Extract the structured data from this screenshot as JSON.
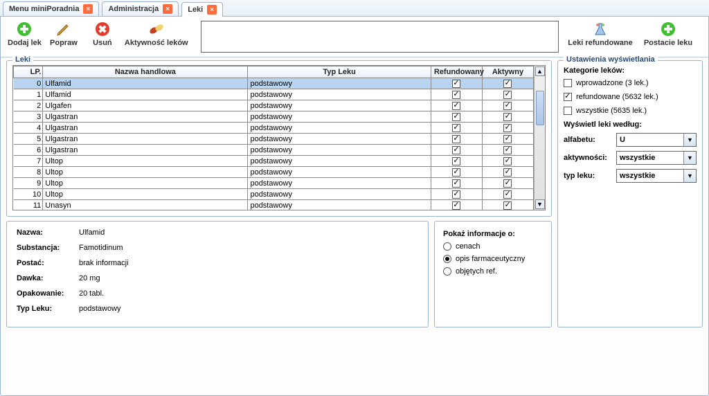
{
  "tabs": [
    {
      "label": "Menu miniPoradnia"
    },
    {
      "label": "Administracja"
    },
    {
      "label": "Leki"
    }
  ],
  "toolbar": {
    "add": "Dodaj lek",
    "edit": "Popraw",
    "del": "Usuń",
    "activity": "Aktywność leków",
    "refunded": "Leki refundowane",
    "forms": "Postacie leku"
  },
  "table": {
    "group_label": "Leki",
    "headers": {
      "lp": "LP.",
      "name": "Nazwa handlowa",
      "type": "Typ Leku",
      "ref": "Refundowany",
      "akt": "Aktywny"
    },
    "rows": [
      {
        "lp": 0,
        "name": "Ulfamid",
        "type": "podstawowy",
        "ref": true,
        "akt": true,
        "sel": true
      },
      {
        "lp": 1,
        "name": "Ulfamid",
        "type": "podstawowy",
        "ref": true,
        "akt": true
      },
      {
        "lp": 2,
        "name": "Ulgafen",
        "type": "podstawowy",
        "ref": true,
        "akt": true
      },
      {
        "lp": 3,
        "name": "Ulgastran",
        "type": "podstawowy",
        "ref": true,
        "akt": true
      },
      {
        "lp": 4,
        "name": "Ulgastran",
        "type": "podstawowy",
        "ref": true,
        "akt": true
      },
      {
        "lp": 5,
        "name": "Ulgastran",
        "type": "podstawowy",
        "ref": true,
        "akt": true
      },
      {
        "lp": 6,
        "name": "Ulgastran",
        "type": "podstawowy",
        "ref": true,
        "akt": true
      },
      {
        "lp": 7,
        "name": "Ultop",
        "type": "podstawowy",
        "ref": true,
        "akt": true
      },
      {
        "lp": 8,
        "name": "Ultop",
        "type": "podstawowy",
        "ref": true,
        "akt": true
      },
      {
        "lp": 9,
        "name": "Ultop",
        "type": "podstawowy",
        "ref": true,
        "akt": true
      },
      {
        "lp": 10,
        "name": "Ultop",
        "type": "podstawowy",
        "ref": true,
        "akt": true
      },
      {
        "lp": 11,
        "name": "Unasyn",
        "type": "podstawowy",
        "ref": true,
        "akt": true
      }
    ]
  },
  "detail": {
    "name_label": "Nazwa:",
    "name": "Ulfamid",
    "subst_label": "Substancja:",
    "subst": "Famotidinum",
    "form_label": "Postać:",
    "form": "brak informacji",
    "dose_label": "Dawka:",
    "dose": "20 mg",
    "pack_label": "Opakowanie:",
    "pack": "20 tabl.",
    "type_label": "Typ Leku:",
    "type": "podstawowy"
  },
  "info": {
    "header": "Pokaż informacje o:",
    "opt1": "cenach",
    "opt2": "opis farmaceutyczny",
    "opt3": "objętych ref."
  },
  "settings": {
    "legend": "Ustawienia wyświetlania",
    "cat_header": "Kategorie leków:",
    "cat1": "wprowadzone (3 lek.)",
    "cat2": "refundowane (5632 lek.)",
    "cat3": "wszystkie (5635 lek.)",
    "view_header": "Wyświetl leki według:",
    "alpha_label": "alfabetu:",
    "alpha_val": "U",
    "active_label": "aktywności:",
    "active_val": "wszystkie",
    "type_label": "typ leku:",
    "type_val": "wszystkie"
  }
}
